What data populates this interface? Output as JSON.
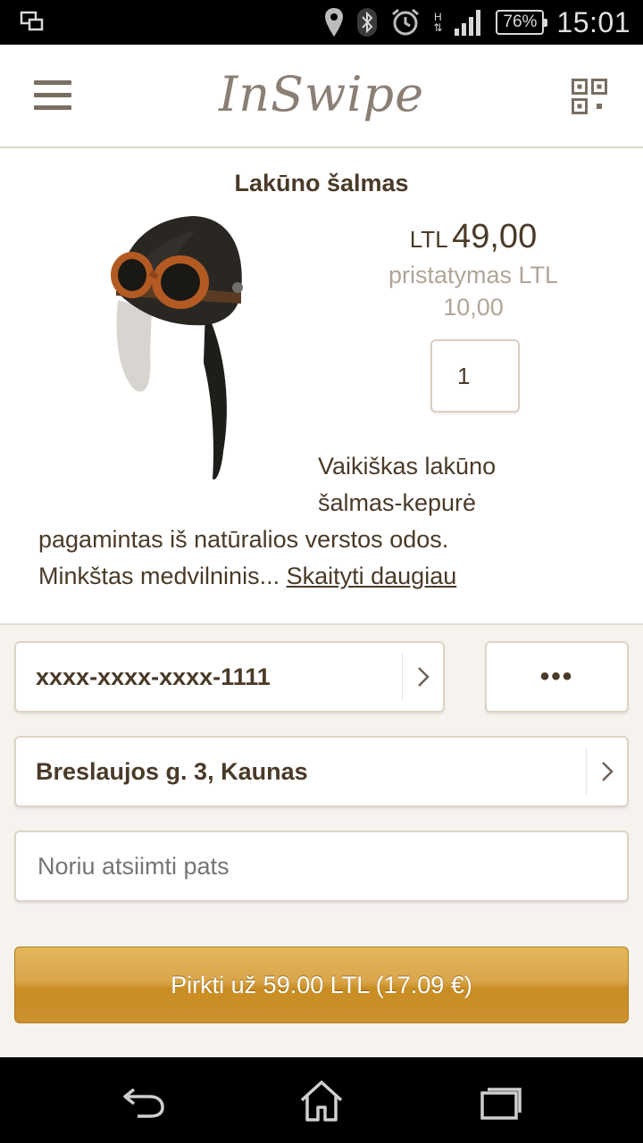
{
  "status_bar": {
    "battery": "76%",
    "network_type": "H",
    "time": "15:01",
    "icons": [
      "screen-mirror-icon",
      "location-icon",
      "bluetooth-icon",
      "alarm-icon",
      "network-type-icon",
      "signal-icon",
      "battery-icon"
    ]
  },
  "header": {
    "logo": "InSwipe",
    "menu_icon": "hamburger-menu-icon",
    "qr_icon": "qr-code-icon"
  },
  "product": {
    "title": "Lakūno šalmas",
    "image": "aviator-hat-image",
    "price_currency": "LTL",
    "price_amount": "49,00",
    "delivery_line1": "pristatymas LTL",
    "delivery_line2": "10,00",
    "quantity": "1",
    "description_line1": "Vaikiškas lakūno",
    "description_line2": "šalmas-kepurė",
    "description_line3": "pagamintas iš natūralios verstos odos.",
    "description_line4": "Minkštas medvilninis...",
    "read_more": "Skaityti daugiau"
  },
  "form": {
    "card_number": "xxxx-xxxx-xxxx-1111",
    "more_options": "•••",
    "address": "Breslaujos g. 3, Kaunas",
    "pickup_placeholder": "Noriu atsiimti pats",
    "buy_button": "Pirkti už 59.00 LTL (17.09 €)"
  },
  "navigation": {
    "icons": [
      "back-icon",
      "home-icon",
      "recent-apps-icon"
    ]
  },
  "colors": {
    "text_brown": "#4a3a28",
    "muted": "#b1a598",
    "button_gold": "#d09433",
    "form_bg": "#f6f3ee"
  }
}
